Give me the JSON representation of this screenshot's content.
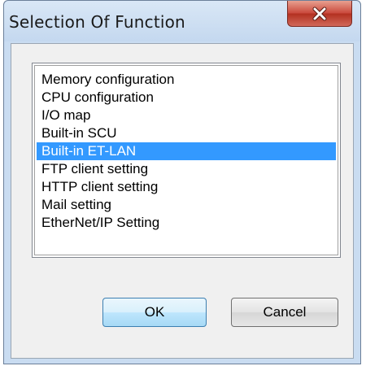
{
  "window": {
    "title": "Selection Of Function",
    "close_icon": "close-x-icon"
  },
  "functions": {
    "items": [
      "Memory configuration",
      "CPU configuration",
      "I/O map",
      "Built-in SCU",
      "Built-in ET-LAN",
      "FTP client setting",
      "HTTP client setting",
      "Mail setting",
      "EtherNet/IP Setting"
    ],
    "selected": "Built-in ET-LAN"
  },
  "buttons": {
    "ok_label": "OK",
    "cancel_label": "Cancel"
  },
  "colors": {
    "selection": "#3399ff",
    "close_button": "#c9473a"
  }
}
